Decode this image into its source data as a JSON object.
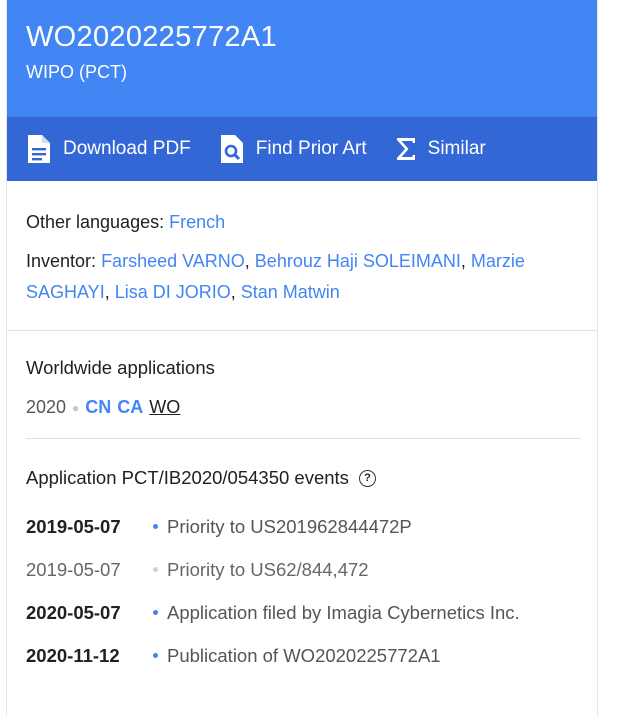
{
  "header": {
    "publication_number": "WO2020225772A1",
    "office": "WIPO (PCT)"
  },
  "toolbar": {
    "download_pdf": "Download PDF",
    "find_prior_art": "Find Prior Art",
    "similar": "Similar"
  },
  "languages": {
    "label": "Other languages:",
    "value": "French"
  },
  "inventor": {
    "label": "Inventor:",
    "names": [
      "Farsheed VARNO",
      "Behrouz Haji SOLEIMANI",
      "Marzie SAGHAYI",
      "Lisa DI JORIO",
      "Stan Matwin"
    ]
  },
  "worldwide": {
    "title": "Worldwide applications",
    "year": "2020",
    "countries": [
      "CN",
      "CA",
      "WO"
    ],
    "current": "WO"
  },
  "events": {
    "title": "Application PCT/IB2020/054350 events",
    "help_glyph": "?",
    "items": [
      {
        "date": "2019-05-07",
        "text": "Priority to US201962844472P",
        "dim": false
      },
      {
        "date": "2019-05-07",
        "text": "Priority to US62/844,472",
        "dim": true
      },
      {
        "date": "2020-05-07",
        "text": "Application filed by Imagia Cybernetics Inc.",
        "dim": false
      },
      {
        "date": "2020-11-12",
        "text": "Publication of WO2020225772A1",
        "dim": false
      }
    ]
  },
  "colors": {
    "header": "#4285f4",
    "toolbar": "#3367d6",
    "link": "#4285f4"
  }
}
